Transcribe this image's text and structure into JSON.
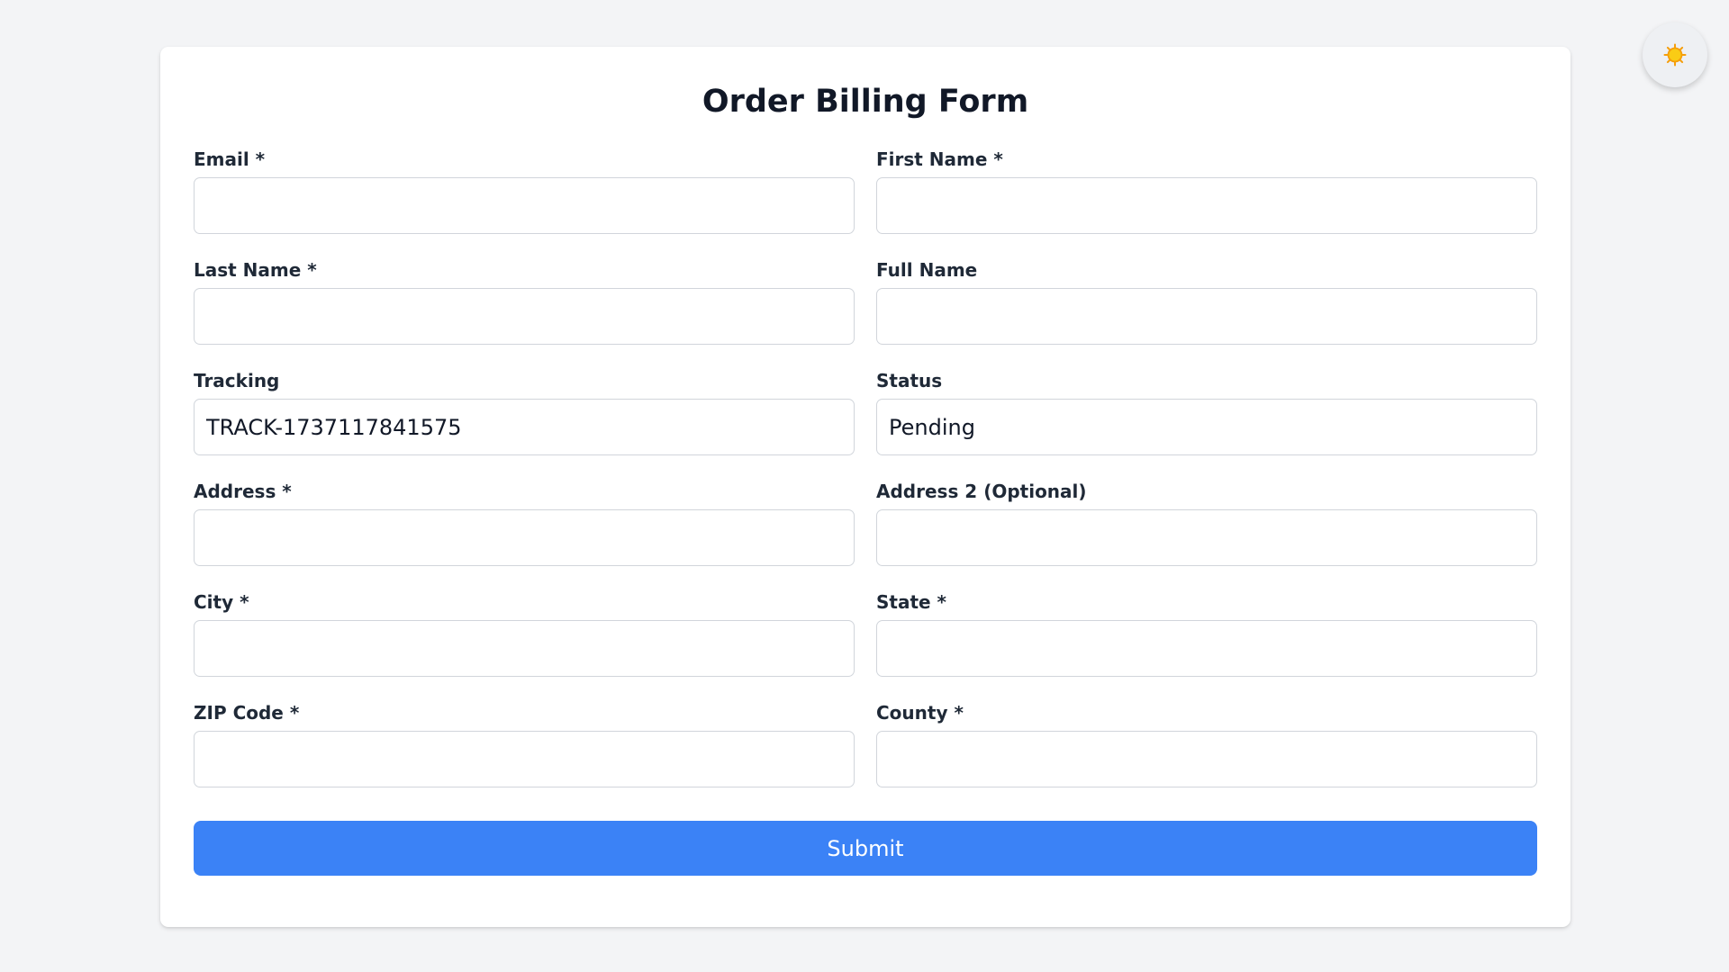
{
  "form": {
    "title": "Order Billing Form",
    "fields": [
      {
        "label": "Email *",
        "value": "",
        "placeholder": ""
      },
      {
        "label": "First Name *",
        "value": "",
        "placeholder": ""
      },
      {
        "label": "Last Name *",
        "value": "",
        "placeholder": ""
      },
      {
        "label": "Full Name",
        "value": "",
        "placeholder": ""
      },
      {
        "label": "Tracking",
        "value": "TRACK-1737117841575",
        "placeholder": ""
      },
      {
        "label": "Status",
        "value": "Pending",
        "placeholder": ""
      },
      {
        "label": "Address *",
        "value": "",
        "placeholder": ""
      },
      {
        "label": "Address 2 (Optional)",
        "value": "",
        "placeholder": ""
      },
      {
        "label": "City *",
        "value": "",
        "placeholder": ""
      },
      {
        "label": "State *",
        "value": "",
        "placeholder": ""
      },
      {
        "label": "ZIP Code *",
        "value": "",
        "placeholder": ""
      },
      {
        "label": "County *",
        "value": "",
        "placeholder": ""
      }
    ],
    "submit_label": "Submit"
  },
  "theme_toggle": {
    "icon": "sun-icon"
  },
  "colors": {
    "page_background": "#f3f4f6",
    "card_background": "#ffffff",
    "accent": "#3b82f6",
    "sun_fill": "#facc15",
    "sun_stroke": "#f59e0b"
  }
}
